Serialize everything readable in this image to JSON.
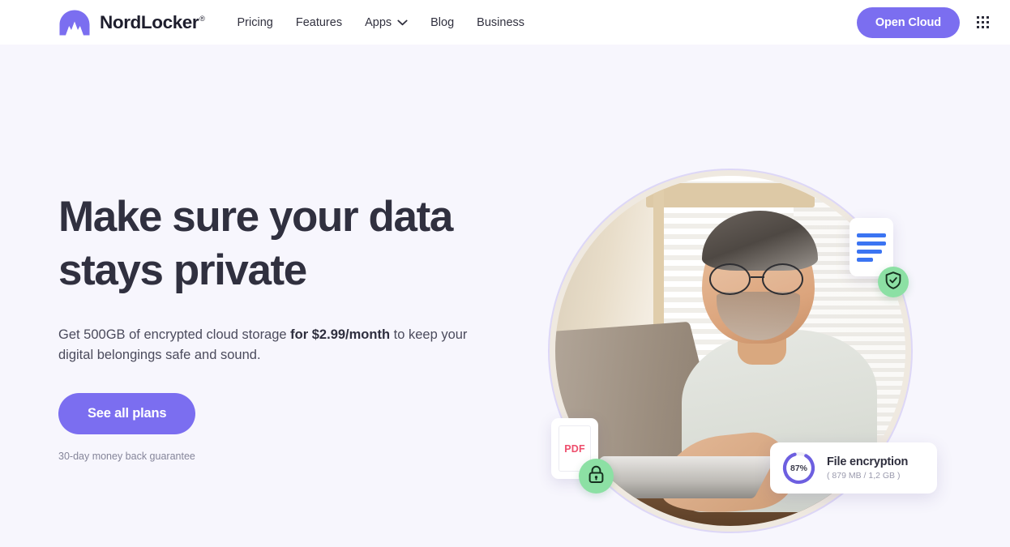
{
  "brand": {
    "name": "NordLocker",
    "logo_icon": "nordlocker-mountain-logo"
  },
  "nav": {
    "items": [
      {
        "label": "Pricing",
        "has_dropdown": false
      },
      {
        "label": "Features",
        "has_dropdown": false
      },
      {
        "label": "Apps",
        "has_dropdown": true,
        "icon": "chevron-down-icon"
      },
      {
        "label": "Blog",
        "has_dropdown": false
      },
      {
        "label": "Business",
        "has_dropdown": false
      }
    ],
    "open_cloud_label": "Open Cloud",
    "apps_grid_icon": "apps-grid-icon"
  },
  "hero": {
    "headline_line1": "Make sure your data",
    "headline_line2": "stays private",
    "subhead_part1": "Get 500GB of encrypted cloud storage ",
    "subhead_bold": "for $2.99/month",
    "subhead_part2": " to keep your digital belongings safe and sound.",
    "cta_label": "See all plans",
    "guarantee": "30-day money back guarantee"
  },
  "visual": {
    "photo_alt": "man-working-on-laptop",
    "doc_card": {
      "icon": "document-lines-icon"
    },
    "shield_badge": {
      "icon": "shield-check-icon"
    },
    "pdf_card": {
      "label": "PDF",
      "icon": "pdf-file-icon"
    },
    "lock_badge": {
      "icon": "padlock-icon"
    },
    "encryption_card": {
      "percent_label": "87%",
      "percent_value": 87,
      "title": "File encryption",
      "subtitle": "( 879 MB / 1,2 GB )"
    }
  },
  "colors": {
    "brand_purple": "#7b6ef0",
    "page_background": "#f7f6fd",
    "header_background": "#ffffff",
    "heading_text": "#30303f",
    "badge_green": "#8ce0a4",
    "pdf_red": "#ee4e6c",
    "doc_blue": "#3b74f2",
    "ring_purple": "#6d5fe0",
    "ring_track": "#efeef7"
  }
}
